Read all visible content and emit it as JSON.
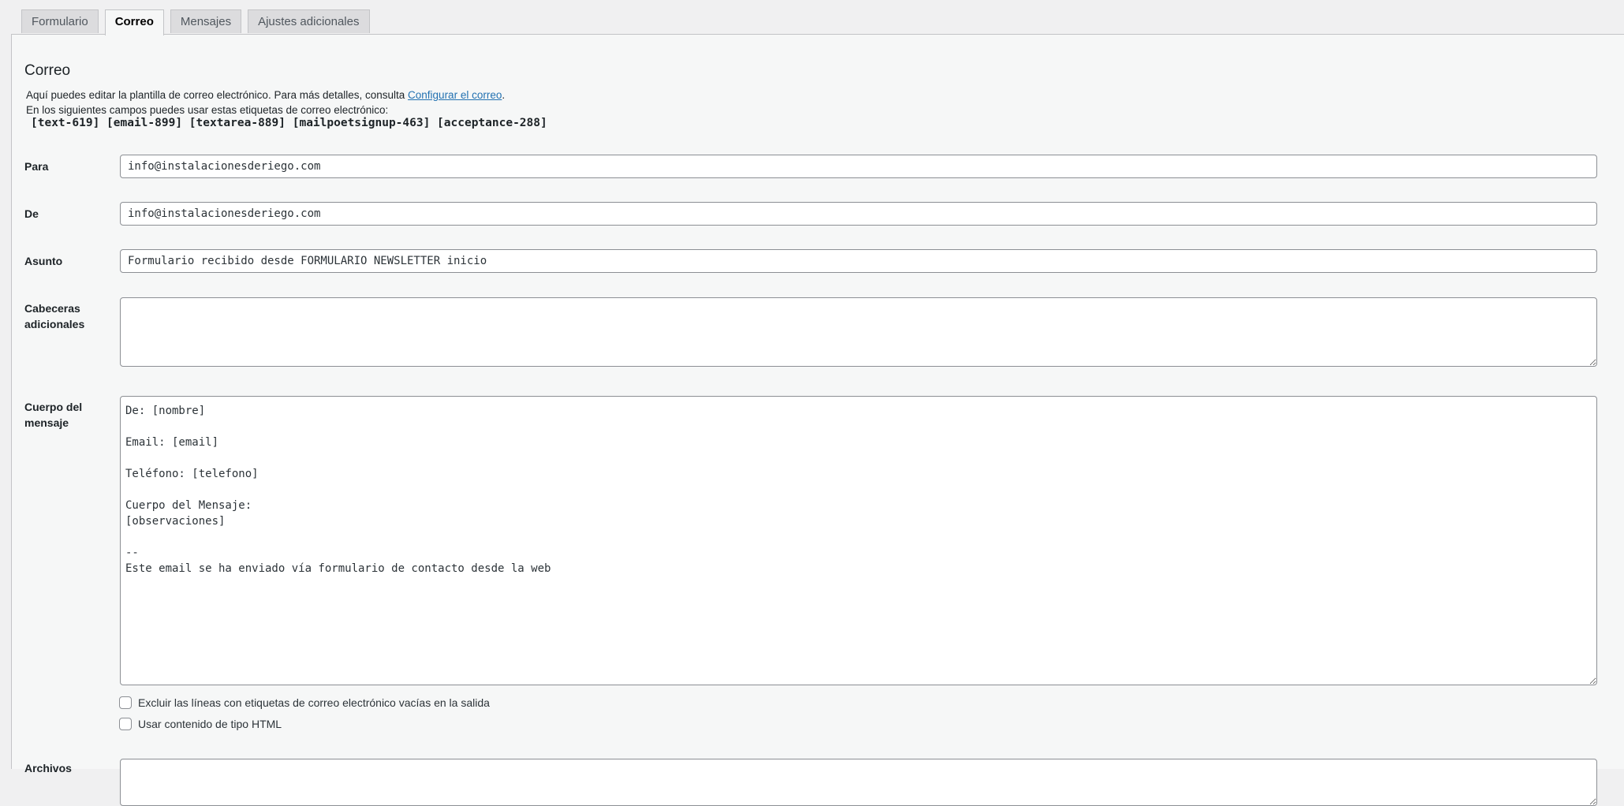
{
  "tabs": [
    {
      "label": "Formulario"
    },
    {
      "label": "Correo",
      "active": true
    },
    {
      "label": "Mensajes"
    },
    {
      "label": "Ajustes adicionales"
    }
  ],
  "mail": {
    "title": "Correo",
    "desc1_prefix": "Aquí puedes editar la plantilla de correo electrónico. Para más detalles, consulta ",
    "desc1_link": "Configurar el correo",
    "desc1_suffix": ".",
    "desc2": "En los siguientes campos puedes usar estas etiquetas de correo electrónico:",
    "tags": "[text-619] [email-899] [textarea-889] [mailpoetsignup-463] [acceptance-288]",
    "fields": {
      "to": {
        "label": "Para",
        "value": "info@instalacionesderiego.com"
      },
      "from": {
        "label": "De",
        "value": "info@instalacionesderiego.com"
      },
      "subject": {
        "label": "Asunto",
        "value": "Formulario recibido desde FORMULARIO NEWSLETTER inicio"
      },
      "headers": {
        "label_line1": "Cabeceras",
        "label_line2": "adicionales",
        "value": ""
      },
      "body": {
        "label_line1": "Cuerpo del",
        "label_line2": "mensaje",
        "value": "De: [nombre]\n\nEmail: [email]\n\nTeléfono: [telefono]\n\nCuerpo del Mensaje:\n[observaciones]\n\n--\nEste email se ha enviado vía formulario de contacto desde la web"
      }
    },
    "options": {
      "exclude_blank": {
        "label": "Excluir las líneas con etiquetas de correo electrónico vacías en la salida",
        "checked": false
      },
      "use_html": {
        "label": "Usar contenido de tipo HTML",
        "checked": false
      }
    },
    "attachments": {
      "label": "Archivos"
    }
  },
  "colors": {
    "link": "#2271b1",
    "background": "#f0f0f1",
    "panel": "#f6f7f7"
  }
}
